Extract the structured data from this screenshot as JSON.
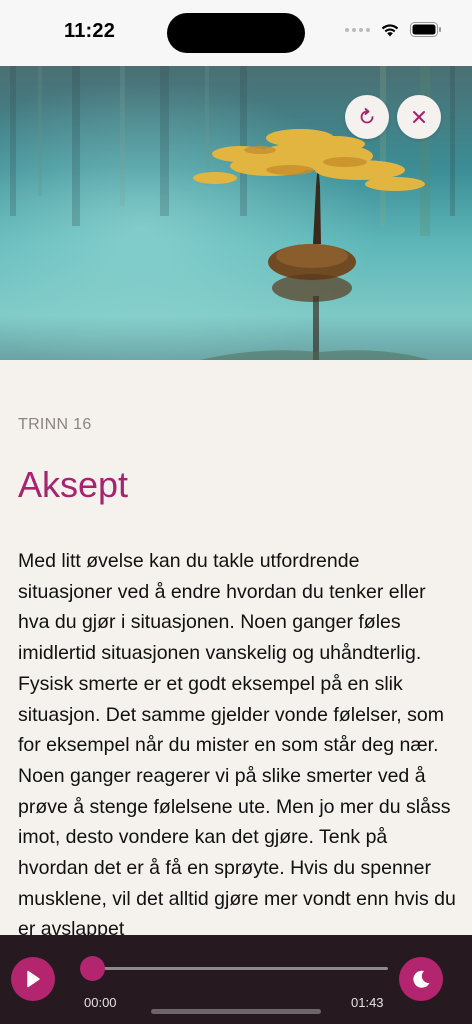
{
  "status_bar": {
    "time": "11:22",
    "icons": [
      "cellular-signal-icon",
      "wifi-icon",
      "battery-icon"
    ]
  },
  "hero": {
    "image_subject": "tree-on-rock-in-lake",
    "buttons": [
      "refresh-icon",
      "close-icon"
    ]
  },
  "lesson": {
    "step_label": "TRINN 16",
    "title": "Aksept",
    "body": "Med litt øvelse kan du takle utfordrende situasjoner ved å endre hvordan du tenker eller hva du gjør i situasjonen. Noen ganger føles imidlertid situasjonen vanskelig og uhåndterlig. Fysisk smerte er et godt eksempel på en slik situasjon. Det samme gjelder vonde følelser, som for eksempel når du mister en som står deg nær. Noen ganger reagerer vi på slike smerter ved å prøve å stenge følelsene ute. Men jo mer du slåss imot, desto vondere kan det gjøre. Tenk på hvordan det er å få en sprøyte. Hvis du spenner musklene, vil det alltid gjøre mer vondt enn hvis du er avslappet"
  },
  "player": {
    "current_time": "00:00",
    "duration": "01:43",
    "progress": 0,
    "icons": [
      "play-icon",
      "moon-icon"
    ]
  },
  "colors": {
    "accent": "#b3256f",
    "title": "#a8226f",
    "player_bg": "#26191f",
    "page_bg": "#f5f2ee"
  }
}
